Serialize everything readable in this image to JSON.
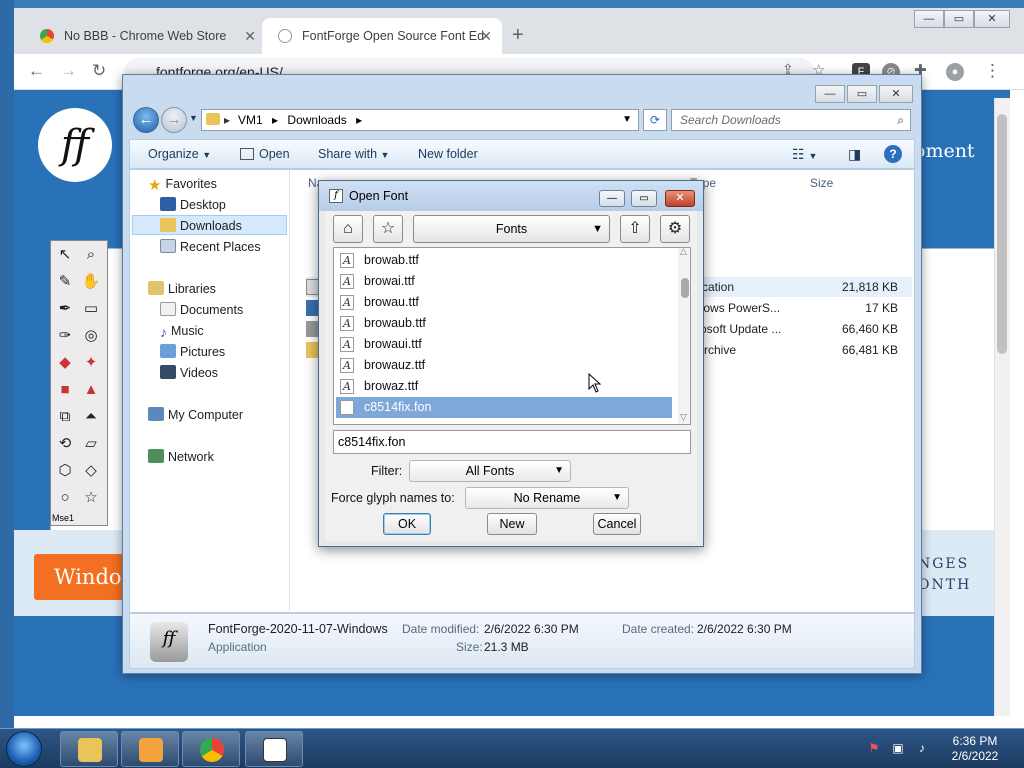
{
  "chrome": {
    "tabs": [
      {
        "title": "No BBB - Chrome Web Store",
        "close": "✕"
      },
      {
        "title": "FontForge Open Source Font Ed",
        "close": "✕"
      }
    ],
    "new_tab": "+",
    "url": "fontforge.org/en-US/",
    "window_controls": [
      "—",
      "▭",
      "✕"
    ]
  },
  "webpage": {
    "logo_text": "ff",
    "heading_fragment": "oment",
    "download_button_fragment": "Window",
    "side_lines": [
      "NGES",
      "ONTH"
    ],
    "toolbox_label": "Mse1"
  },
  "explorer": {
    "window_controls": [
      "—",
      "▭",
      "✕"
    ],
    "breadcrumb": [
      "VM1",
      "Downloads"
    ],
    "search_placeholder": "Search Downloads",
    "commands": {
      "organize": "Organize",
      "open": "Open",
      "share_with": "Share with",
      "new_folder": "New folder"
    },
    "nav": {
      "favorites": "Favorites",
      "desktop": "Desktop",
      "downloads": "Downloads",
      "recent_places": "Recent Places",
      "libraries": "Libraries",
      "documents": "Documents",
      "music": "Music",
      "pictures": "Pictures",
      "videos": "Videos",
      "my_computer": "My Computer",
      "network": "Network"
    },
    "columns": {
      "name": "Na",
      "type": "Type",
      "size": "Size"
    },
    "files": [
      {
        "type": "plication",
        "size": "21,818 KB"
      },
      {
        "type": "ndows PowerS...",
        "size": "17 KB"
      },
      {
        "type": "crosoft Update ...",
        "size": "66,460 KB"
      },
      {
        "type": "Archive",
        "size": "66,481 KB"
      }
    ],
    "details": {
      "name": "FontForge-2020-11-07-Windows",
      "kind": "Application",
      "date_modified_label": "Date modified:",
      "date_modified": "2/6/2022 6:30 PM",
      "date_created_label": "Date created:",
      "date_created": "2/6/2022 6:30 PM",
      "size_label": "Size:",
      "size": "21.3 MB"
    }
  },
  "open_font": {
    "title": "Open Font",
    "directory": "Fonts",
    "files": [
      "browab.ttf",
      "browai.ttf",
      "browau.ttf",
      "browaub.ttf",
      "browaui.ttf",
      "browauz.ttf",
      "browaz.ttf",
      "c8514fix.fon"
    ],
    "selected_file": "c8514fix.fon",
    "filename": "c8514fix.fon",
    "filter_label": "Filter:",
    "filter_value": "All Fonts",
    "glyph_label": "Force glyph names to:",
    "glyph_value": "No Rename",
    "ok": "OK",
    "new": "New",
    "cancel": "Cancel"
  },
  "taskbar": {
    "time": "6:36 PM",
    "date": "2/6/2022"
  }
}
